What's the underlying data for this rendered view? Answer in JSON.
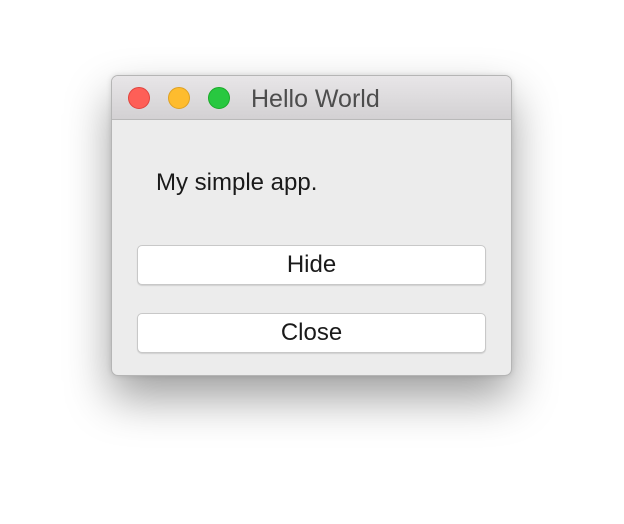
{
  "window": {
    "title": "Hello World",
    "controls": {
      "close": {
        "icon": "close-traffic-light",
        "color": "#fe5f57"
      },
      "minimize": {
        "icon": "minimize-traffic-light",
        "color": "#febc2e"
      },
      "zoom": {
        "icon": "zoom-traffic-light",
        "color": "#28c840"
      }
    }
  },
  "content": {
    "label": "My simple app.",
    "buttons": {
      "hide": "Hide",
      "close": "Close"
    }
  }
}
